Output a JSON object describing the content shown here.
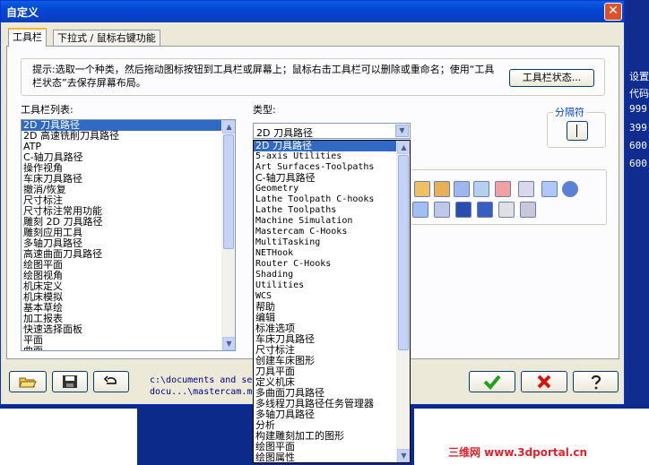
{
  "window": {
    "title": "自定义",
    "close_glyph": "✕"
  },
  "tabs": [
    {
      "label": "工具栏"
    },
    {
      "label": "下拉式 / 鼠标右键功能"
    }
  ],
  "info": {
    "text": "提示:选取一个种类，然后拖动图标按钮到工具栏或屏幕上；鼠标右击工具栏可以删除或重命名；使用“工具栏状态”去保存屏幕布局。",
    "toolbar_state_button": "工具栏状态..."
  },
  "toolbar_list": {
    "label": "工具栏列表:",
    "items": [
      "2D 刀具路径",
      "2D 高速铣削刀具路径",
      "ATP",
      "C-轴刀具路径",
      "操作视角",
      "车床刀具路径",
      "撤消/恢复",
      "尺寸标注",
      "尺寸标注常用功能",
      "雕刻 2D 刀具路径",
      "雕刻应用工具",
      "多轴刀具路径",
      "高速曲面刀具路径",
      "绘图平面",
      "绘图视角",
      "机床定义",
      "机床模拟",
      "基本草绘",
      "加工报表",
      "快速选择面板",
      "平面",
      "曲面"
    ],
    "selected_index": 0
  },
  "category": {
    "label": "类型:",
    "selected": "2D 刀具路径",
    "options": [
      "2D 刀具路径",
      "5-axis Utilities",
      "Art Surfaces-Toolpaths",
      "C-轴刀具路径",
      "Geometry",
      "Lathe Toolpath C-hooks",
      "Lathe Toolpaths",
      "Machine Simulation",
      "Mastercam C-Hooks",
      "MultiTasking",
      "NETHook",
      "Router C-Hooks",
      "Shading",
      "Utilities",
      "WCS",
      "帮助",
      "编辑",
      "标准选项",
      "车床刀具路径",
      "尺寸标注",
      "创建车床图形",
      "刀具平面",
      "定义机床",
      "多曲面刀具路径",
      "多线程刀具路径任务管理器",
      "多轴刀具路径",
      "分析",
      "构建雕刻加工的图形",
      "绘图平面",
      "绘图属性"
    ]
  },
  "separator": {
    "label": "分隔符"
  },
  "toolbar_file": {
    "line1": "c:\\documents and se",
    "line2": "docu...\\mastercam.m"
  },
  "buttons": {
    "open_icon": "open-folder-icon",
    "save_icon": "save-disk-icon",
    "reset_icon": "undo-arrow-icon",
    "ok_icon": "check-icon",
    "cancel_icon": "x-icon",
    "help_icon": "question-icon"
  },
  "background": {
    "right_text": [
      "设置",
      "代码",
      "999",
      "399",
      "600",
      "600"
    ],
    "watermark": "三维网 www.3dportal.cn"
  },
  "colors": {
    "title_bar": "#0346d4",
    "selection": "#316ac5",
    "ok_green": "#1fa01f",
    "cancel_red": "#d01515",
    "watermark": "#e0222a"
  }
}
